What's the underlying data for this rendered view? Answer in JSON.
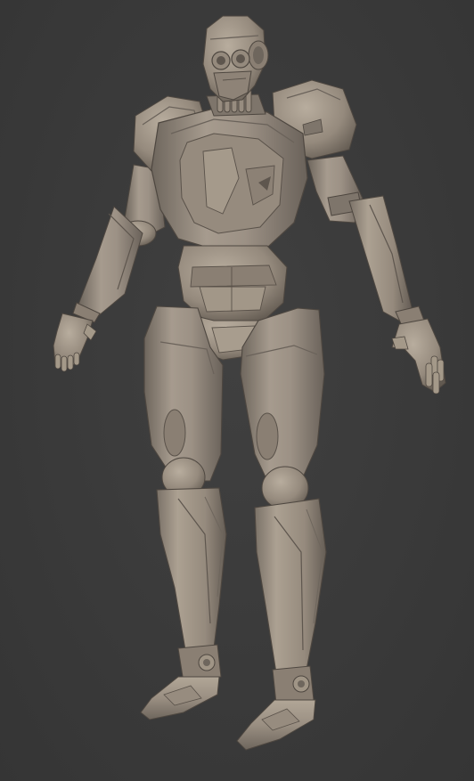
{
  "scene": {
    "subject": "robot-sculpt",
    "colors": {
      "background": "#3a3a3a",
      "clay_base": "#9a8f82",
      "clay_light": "#b3a899",
      "clay_mid": "#8a7f73",
      "clay_dark": "#5e564e",
      "clay_shadow": "#463f39"
    }
  }
}
